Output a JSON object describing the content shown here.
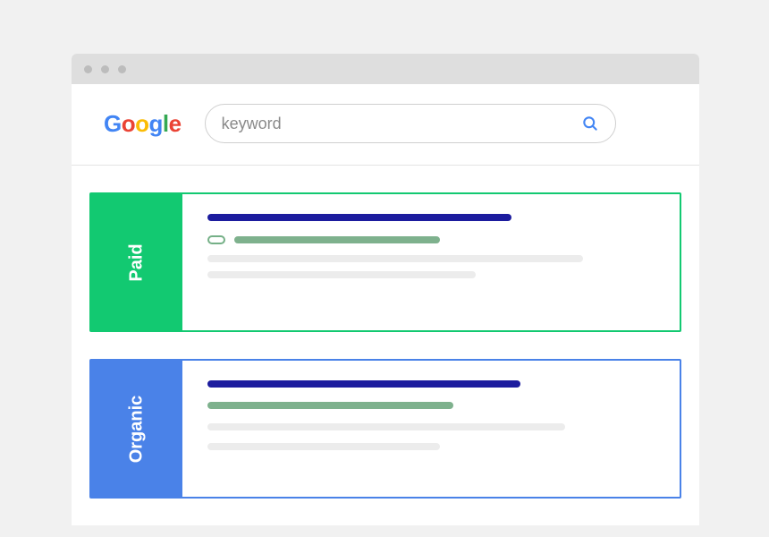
{
  "logo": {
    "g1": "G",
    "o1": "o",
    "o2": "o",
    "g2": "g",
    "l": "l",
    "e": "e"
  },
  "search": {
    "placeholder": "keyword"
  },
  "labels": {
    "paid": "Paid",
    "organic": "Organic"
  },
  "colors": {
    "paid_accent": "#12c971",
    "organic_accent": "#4a82e8",
    "title_bar": "#1c1c9e",
    "url_bar": "#7eb18d",
    "snippet_bar": "#ececec"
  }
}
